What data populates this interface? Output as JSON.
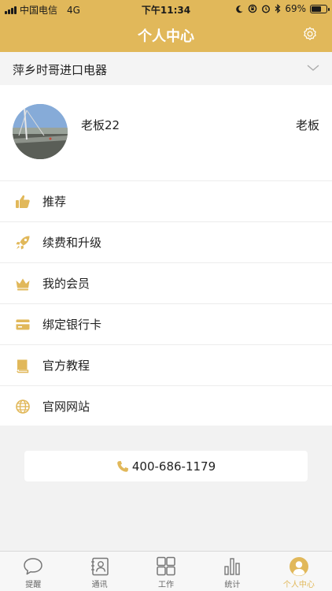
{
  "status_bar": {
    "carrier": "中国电信",
    "network": "4G",
    "time": "下午11:34",
    "battery": "69%",
    "battery_level": 0.69
  },
  "header": {
    "title": "个人中心"
  },
  "company": {
    "name": "萍乡时哥进口电器"
  },
  "profile": {
    "username": "老板22",
    "role": "老板"
  },
  "menu": {
    "items": [
      {
        "label": "推荐",
        "icon": "thumbs-up-icon"
      },
      {
        "label": "续费和升级",
        "icon": "rocket-icon"
      },
      {
        "label": "我的会员",
        "icon": "crown-icon"
      },
      {
        "label": "绑定银行卡",
        "icon": "bank-card-icon"
      },
      {
        "label": "官方教程",
        "icon": "book-icon"
      },
      {
        "label": "官网网站",
        "icon": "globe-icon"
      }
    ]
  },
  "contact": {
    "phone": "400-686-1179"
  },
  "tabbar": {
    "tabs": [
      {
        "label": "提醒",
        "icon": "chat-bubble-icon"
      },
      {
        "label": "通讯",
        "icon": "contacts-icon"
      },
      {
        "label": "工作",
        "icon": "grid-icon"
      },
      {
        "label": "统计",
        "icon": "bar-chart-icon"
      },
      {
        "label": "个人中心",
        "icon": "user-avatar-icon"
      }
    ],
    "active_index": 4
  },
  "colors": {
    "accent": "#e1b85a",
    "background": "#f2f2f2"
  }
}
